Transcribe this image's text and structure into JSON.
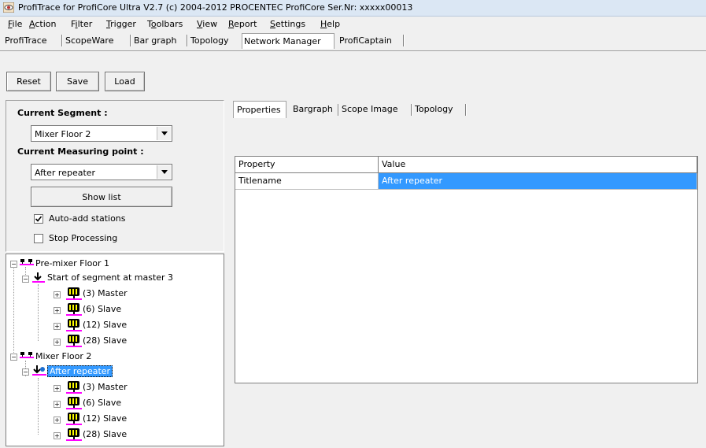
{
  "window": {
    "title": "ProfiTrace for ProfiCore Ultra V2.7 (c) 2004-2012 PROCENTEC  ProfiCore Ser.Nr: xxxxx00013"
  },
  "menu": [
    {
      "u": "F",
      "rest": "ile"
    },
    {
      "u": "A",
      "rest": "ction"
    },
    {
      "pre": "F",
      "u": "i",
      "rest": "lter"
    },
    {
      "u": "T",
      "rest": "rigger"
    },
    {
      "pre": "T",
      "u": "o",
      "rest": "olbars"
    },
    {
      "u": "V",
      "rest": "iew"
    },
    {
      "u": "R",
      "rest": "eport"
    },
    {
      "u": "S",
      "rest": "ettings"
    },
    {
      "u": "H",
      "rest": "elp"
    }
  ],
  "main_tabs": [
    "ProfiTrace",
    "ScopeWare",
    "Bar graph",
    "Topology",
    "Network Manager",
    "ProfiCaptain"
  ],
  "main_tab_active": "Network Manager",
  "toolbar": {
    "reset": "Reset",
    "save": "Save",
    "load": "Load"
  },
  "segment": {
    "label": "Current Segment :",
    "value": "Mixer Floor 2",
    "mp_label": "Current Measuring point :",
    "mp_value": "After repeater",
    "show_list": "Show list",
    "auto_add": "Auto-add stations",
    "auto_add_checked": true,
    "stop_processing": "Stop Processing",
    "stop_processing_checked": false
  },
  "tree": {
    "seg1": "Pre-mixer Floor 1",
    "seg1_mp": "Start of segment at master 3",
    "seg1_stations": [
      "(3) Master",
      "(6) Slave",
      "(12) Slave",
      "(28) Slave"
    ],
    "seg2": "Mixer Floor 2",
    "seg2_mp": "After repeater",
    "seg2_stations": [
      "(3) Master",
      "(6) Slave",
      "(12) Slave",
      "(28) Slave"
    ]
  },
  "sub_tabs": [
    "Properties",
    "Bargraph",
    "Scope Image",
    "Topology"
  ],
  "sub_tab_active": "Properties",
  "grid": {
    "headers": [
      "Property",
      "Value"
    ],
    "rows": [
      {
        "property": "Titlename",
        "value": "After repeater"
      }
    ]
  },
  "colors": {
    "selection": "#3399ff",
    "device_marker": "#ff00ff"
  }
}
